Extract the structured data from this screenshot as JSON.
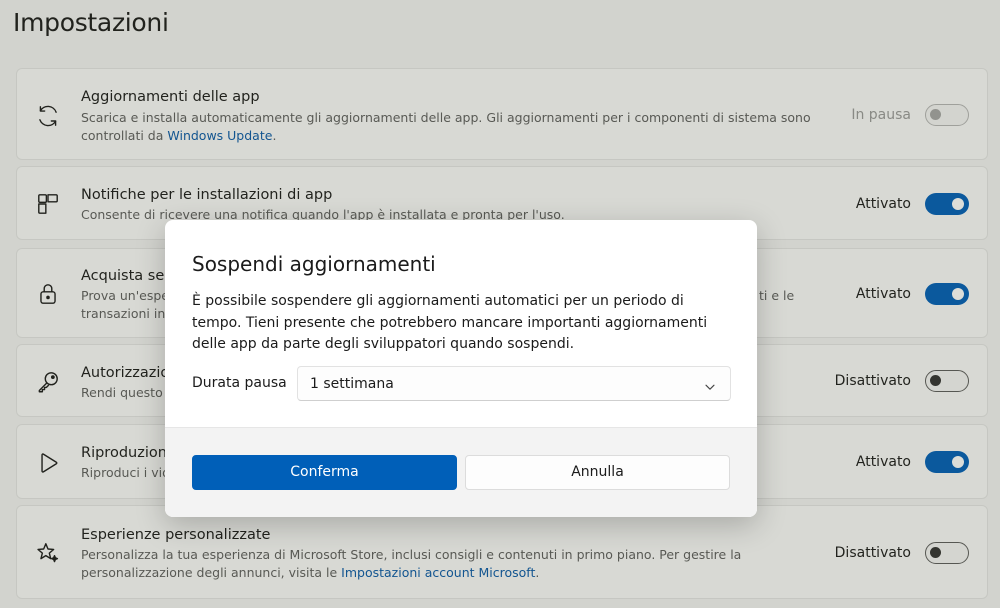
{
  "page": {
    "title": "Impostazioni"
  },
  "settings": [
    {
      "icon": "refresh-icon",
      "title": "Aggiornamenti delle app",
      "desc": "Scarica e installa automaticamente gli aggiornamenti delle app. Gli aggiornamenti per i componenti di sistema sono",
      "desc2": "controllati da ",
      "link": "Windows Update",
      "link_suffix": ".",
      "state": "In pausa",
      "toggle": "disabled"
    },
    {
      "icon": "notification-icon",
      "title": "Notifiche per le installazioni di app",
      "desc": "Consente di ricevere una notifica quando l'app è installata e pronta per l'uso.",
      "state": "Attivato",
      "toggle": "on"
    },
    {
      "icon": "lock-icon",
      "title": "Acquista sen",
      "desc": "Prova un'espe",
      "desc_tail": "ti e le",
      "desc2": "transazioni in-",
      "state": "Attivato",
      "toggle": "on"
    },
    {
      "icon": "key-icon",
      "title": "Autorizzazio",
      "desc": "Rendi questo",
      "state": "Disattivato",
      "toggle": "off"
    },
    {
      "icon": "play-icon",
      "title": "Riproduzione",
      "desc": "Riproduci i vid",
      "state": "Attivato",
      "toggle": "on"
    },
    {
      "icon": "sparkle-star-icon",
      "title": "Esperienze personalizzate",
      "desc": "Personalizza la tua esperienza di Microsoft Store, inclusi consigli e contenuti in primo piano. Per gestire la",
      "desc2": "personalizzazione degli annunci, visita le ",
      "link": "Impostazioni account Microsoft",
      "link_suffix": ".",
      "state": "Disattivato",
      "toggle": "off"
    }
  ],
  "dialog": {
    "title": "Sospendi aggiornamenti",
    "body": "È possibile sospendere gli aggiornamenti automatici per un periodo di tempo. Tieni presente che potrebbero mancare importanti aggiornamenti delle app da parte degli sviluppatori quando sospendi.",
    "pause_label": "Durata pausa",
    "pause_value": "1 settimana",
    "confirm_label": "Conferma",
    "cancel_label": "Annulla"
  },
  "colors": {
    "accent": "#005fb8",
    "link": "#0a5aa8"
  }
}
